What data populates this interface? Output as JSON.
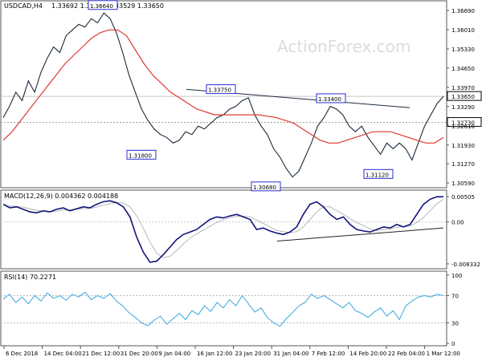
{
  "chart_data": [
    {
      "type": "candlestick",
      "panel": "price",
      "header": {
        "symbol": "USDCAD,H4",
        "ohlc": "1.33692 1.33704 1.33529 1.33650"
      },
      "watermark": "ActionForex.com",
      "yticks": [
        "1.36690",
        "1.36010",
        "1.35330",
        "1.34650",
        "1.33970",
        "1.33290",
        "1.32610",
        "1.31930",
        "1.31270",
        "1.30590"
      ],
      "ylim": [
        1.3059,
        1.3669
      ],
      "current_price": {
        "label": "1.33650",
        "value": 1.3365
      },
      "level_box": {
        "label": "1.32730",
        "value": 1.3273
      },
      "annotations": [
        {
          "label": "1.36640",
          "value": 1.3664
        },
        {
          "label": "1.31800",
          "value": 1.318
        },
        {
          "label": "1.33750",
          "value": 1.3375
        },
        {
          "label": "1.30680",
          "value": 1.3068
        },
        {
          "label": "1.33400",
          "value": 1.334
        },
        {
          "label": "1.31120",
          "value": 1.3112
        }
      ],
      "close": [
        1.329,
        1.333,
        1.338,
        1.335,
        1.342,
        1.338,
        1.345,
        1.35,
        1.354,
        1.352,
        1.358,
        1.36,
        1.362,
        1.361,
        1.364,
        1.3625,
        1.366,
        1.364,
        1.359,
        1.352,
        1.344,
        1.338,
        1.332,
        1.328,
        1.325,
        1.323,
        1.322,
        1.32,
        1.321,
        1.324,
        1.323,
        1.326,
        1.325,
        1.327,
        1.329,
        1.33,
        1.332,
        1.333,
        1.335,
        1.336,
        1.33,
        1.326,
        1.323,
        1.318,
        1.315,
        1.311,
        1.308,
        1.31,
        1.315,
        1.32,
        1.326,
        1.329,
        1.333,
        1.332,
        1.33,
        1.326,
        1.324,
        1.326,
        1.322,
        1.319,
        1.316,
        1.32,
        1.318,
        1.32,
        1.318,
        1.314,
        1.32,
        1.326,
        1.33,
        1.334,
        1.3365
      ],
      "ma": [
        1.321,
        1.324,
        1.328,
        1.332,
        1.336,
        1.34,
        1.344,
        1.348,
        1.351,
        1.354,
        1.357,
        1.359,
        1.36,
        1.36,
        1.358,
        1.353,
        1.348,
        1.344,
        1.341,
        1.338,
        1.336,
        1.334,
        1.332,
        1.331,
        1.33,
        1.33,
        1.33,
        1.33,
        1.33,
        1.33,
        1.3295,
        1.329,
        1.328,
        1.327,
        1.325,
        1.323,
        1.321,
        1.32,
        1.32,
        1.321,
        1.322,
        1.323,
        1.324,
        1.324,
        1.324,
        1.323,
        1.322,
        1.321,
        1.32,
        1.32,
        1.322
      ],
      "trendline": {
        "from": 1.339,
        "to": 1.3325
      },
      "xticks": [
        "6 Dec 2018",
        "14 Dec 04:00",
        "21 Dec 12:00",
        "31 Dec 20:00",
        "9 Jan 04:00",
        "16 Jan 12:00",
        "23 Jan 20:00",
        "31 Jan 04:00",
        "7 Feb 12:00",
        "14 Feb 20:00",
        "22 Feb 04:00",
        "1 Mar 12:00"
      ]
    },
    {
      "type": "line",
      "panel": "macd",
      "header": "MACD(12,26,9) 0.004362 0.004188",
      "yticks": [
        "0.00505",
        "0.00",
        "-0.008332"
      ],
      "ylim": [
        -0.0085,
        0.0052
      ],
      "macd": [
        0.0035,
        0.0028,
        0.003,
        0.0025,
        0.002,
        0.0018,
        0.0022,
        0.002,
        0.0025,
        0.0028,
        0.0022,
        0.0026,
        0.003,
        0.0028,
        0.0035,
        0.004,
        0.0042,
        0.0038,
        0.003,
        0.001,
        -0.003,
        -0.006,
        -0.008,
        -0.0078,
        -0.0065,
        -0.005,
        -0.0035,
        -0.0025,
        -0.002,
        -0.0015,
        -0.0005,
        0.0005,
        0.001,
        0.0008,
        0.0012,
        0.0015,
        0.001,
        0.0005,
        -0.0015,
        -0.0012,
        -0.0018,
        -0.0022,
        -0.0025,
        -0.002,
        -0.001,
        0.0015,
        0.0035,
        0.004,
        0.003,
        0.0015,
        0.0005,
        0.001,
        -0.0005,
        -0.0015,
        -0.0018,
        -0.002,
        -0.0015,
        -0.001,
        -0.0012,
        -0.0005,
        -0.001,
        -0.0005,
        0.0015,
        0.0035,
        0.0045,
        0.005,
        0.005
      ],
      "trendline": {
        "from": -0.0038,
        "to": -0.0012
      }
    },
    {
      "type": "line",
      "panel": "rsi",
      "header": "RSI(14) 70.2271",
      "yticks": [
        "100",
        "70",
        "30",
        "0"
      ],
      "ylim": [
        0,
        100
      ],
      "rsi": [
        65,
        72,
        60,
        68,
        58,
        70,
        62,
        74,
        66,
        70,
        63,
        72,
        68,
        75,
        64,
        70,
        66,
        73,
        62,
        55,
        45,
        38,
        30,
        26,
        34,
        40,
        28,
        36,
        44,
        35,
        48,
        42,
        55,
        47,
        60,
        52,
        64,
        55,
        70,
        58,
        46,
        52,
        38,
        30,
        25,
        36,
        45,
        55,
        60,
        72,
        66,
        70,
        64,
        58,
        52,
        60,
        48,
        44,
        38,
        46,
        52,
        40,
        48,
        35,
        55,
        62,
        68,
        70,
        68,
        72,
        70
      ]
    }
  ]
}
